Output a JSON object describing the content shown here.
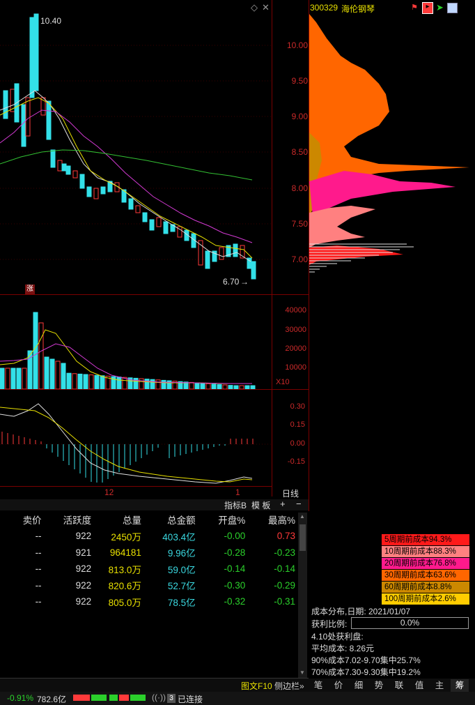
{
  "stock": {
    "code": "300329",
    "name": "海伦钢琴"
  },
  "price_axis": [
    "10.00",
    "9.50",
    "9.00",
    "8.50",
    "8.00",
    "7.50",
    "7.00"
  ],
  "price_annotations": {
    "high": "10.40",
    "low": "6.70",
    "up_mark": "涨"
  },
  "volume_axis": [
    "40000",
    "30000",
    "20000",
    "10000"
  ],
  "volume_unit": "X10",
  "macd_axis": [
    "0.30",
    "0.15",
    "0.00",
    "-0.15"
  ],
  "time_axis": {
    "label1": "12",
    "label2": "1"
  },
  "period_button": "日线",
  "indicator_tabs": [
    "指标B",
    "模 板",
    "+",
    "−"
  ],
  "table": {
    "headers": [
      "卖价",
      "活跃度",
      "总量",
      "总金额",
      "开盘%",
      "最高%"
    ],
    "rows": [
      {
        "sell": "--",
        "activity": "922",
        "volume": "2450万",
        "amount": "403.4亿",
        "open": "-0.00",
        "high": "0.73"
      },
      {
        "sell": "--",
        "activity": "921",
        "volume": "964181",
        "amount": "9.96亿",
        "open": "-0.28",
        "high": "-0.23"
      },
      {
        "sell": "--",
        "activity": "922",
        "volume": "813.0万",
        "amount": "59.0亿",
        "open": "-0.14",
        "high": "-0.14"
      },
      {
        "sell": "--",
        "activity": "922",
        "volume": "820.6万",
        "amount": "52.7亿",
        "open": "-0.30",
        "high": "-0.29"
      },
      {
        "sell": "--",
        "activity": "922",
        "volume": "805.0万",
        "amount": "78.5亿",
        "open": "-0.32",
        "high": "-0.31"
      }
    ]
  },
  "cost_legend": [
    {
      "label": "5周期前成本94.3%",
      "color": "#ff1a1a"
    },
    {
      "label": "10周期前成本88.3%",
      "color": "#ff8080"
    },
    {
      "label": "20周期前成本76.8%",
      "color": "#ff1a8c"
    },
    {
      "label": "30周期前成本63.6%",
      "color": "#ff6600"
    },
    {
      "label": "60周期前成本8.8%",
      "color": "#cc8800"
    },
    {
      "label": "100周期前成本2.6%",
      "color": "#ffcc00"
    }
  ],
  "cost_info": {
    "date_line": "成本分布,日期:  2021/01/07",
    "profit_label": "获利比例:",
    "profit_value": "0.0%",
    "profit_disk": "4.10处获利盘:",
    "avg_cost": "平均成本:  8.26元",
    "c90": "90%成本7.02-9.70集中25.7%",
    "c70": "70%成本7.30-9.30集中19.2%"
  },
  "side_tabs": [
    "图文F10",
    "侧边栏»"
  ],
  "right_tabs": [
    "笔",
    "价",
    "细",
    "势",
    "联",
    "值",
    "主",
    "筹"
  ],
  "status": {
    "change": "-0.91%",
    "amount": "782.6亿",
    "connections": "3",
    "connected": "已连接"
  }
}
